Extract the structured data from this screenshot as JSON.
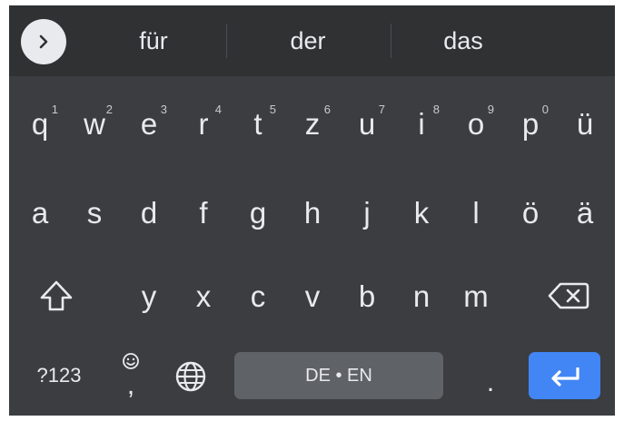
{
  "suggestions": [
    "für",
    "der",
    "das"
  ],
  "rows": [
    [
      {
        "name": "key-q",
        "label": "q",
        "hint": "1"
      },
      {
        "name": "key-w",
        "label": "w",
        "hint": "2"
      },
      {
        "name": "key-e",
        "label": "e",
        "hint": "3"
      },
      {
        "name": "key-r",
        "label": "r",
        "hint": "4"
      },
      {
        "name": "key-t",
        "label": "t",
        "hint": "5"
      },
      {
        "name": "key-z",
        "label": "z",
        "hint": "6"
      },
      {
        "name": "key-u",
        "label": "u",
        "hint": "7"
      },
      {
        "name": "key-i",
        "label": "i",
        "hint": "8"
      },
      {
        "name": "key-o",
        "label": "o",
        "hint": "9"
      },
      {
        "name": "key-p",
        "label": "p",
        "hint": "0"
      },
      {
        "name": "key-u-umlaut",
        "label": "ü",
        "hint": ""
      }
    ],
    [
      {
        "name": "key-a",
        "label": "a"
      },
      {
        "name": "key-s",
        "label": "s"
      },
      {
        "name": "key-d",
        "label": "d"
      },
      {
        "name": "key-f",
        "label": "f"
      },
      {
        "name": "key-g",
        "label": "g"
      },
      {
        "name": "key-h",
        "label": "h"
      },
      {
        "name": "key-j",
        "label": "j"
      },
      {
        "name": "key-k",
        "label": "k"
      },
      {
        "name": "key-l",
        "label": "l"
      },
      {
        "name": "key-o-umlaut",
        "label": "ö"
      },
      {
        "name": "key-a-umlaut",
        "label": "ä"
      }
    ],
    [
      {
        "name": "key-y",
        "label": "y"
      },
      {
        "name": "key-x",
        "label": "x"
      },
      {
        "name": "key-c",
        "label": "c"
      },
      {
        "name": "key-v",
        "label": "v"
      },
      {
        "name": "key-b",
        "label": "b"
      },
      {
        "name": "key-n",
        "label": "n"
      },
      {
        "name": "key-m",
        "label": "m"
      }
    ]
  ],
  "bottom": {
    "symbols_label": "?123",
    "comma_label": ",",
    "emoji_icon": "smiley-icon",
    "language_icon": "globe-icon",
    "space_label": "DE • EN",
    "period_label": "."
  },
  "icons": {
    "toggle": "chevron-right-icon",
    "shift": "shift-arrow-icon",
    "backspace": "backspace-icon",
    "enter": "return-arrow-icon"
  },
  "colors": {
    "keyboard_bg": "#3b3d40",
    "suggestion_bar_bg": "#2f3133",
    "key_text": "#e8eaed",
    "spacebar_bg": "#5f6368",
    "enter_accent": "#4285f4"
  }
}
